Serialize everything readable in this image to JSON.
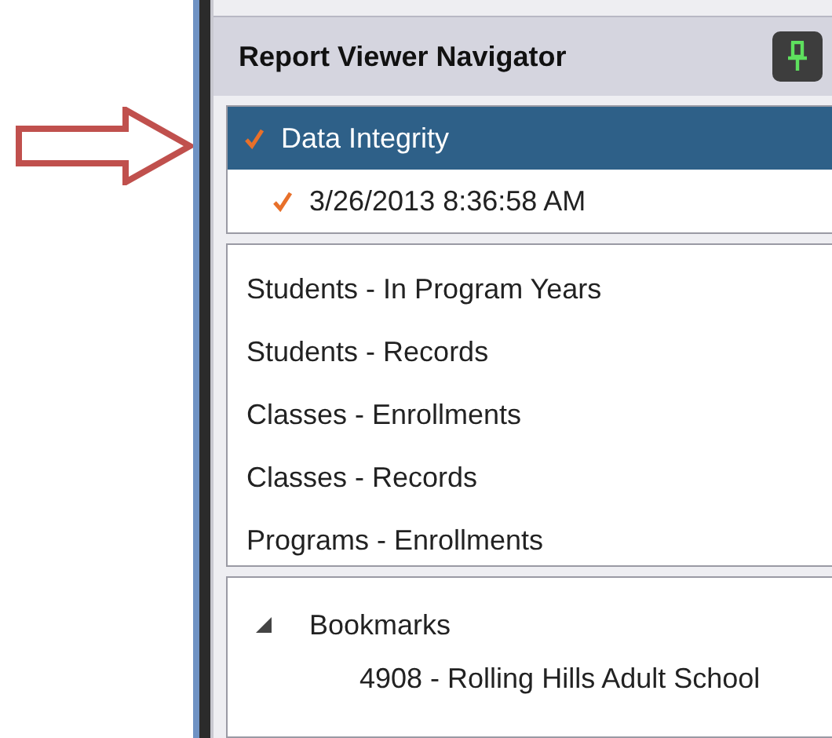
{
  "panel": {
    "title": "Report Viewer Navigator",
    "pin_button": {
      "pinned": true
    }
  },
  "report_tree": [
    {
      "label": "Data Integrity",
      "checked": true,
      "selected": true
    },
    {
      "label": "3/26/2013 8:36:58 AM",
      "checked": true,
      "selected": false
    }
  ],
  "reports": [
    {
      "label": "Students - In Program Years",
      "selected": false
    },
    {
      "label": "Students - Records",
      "selected": false
    },
    {
      "label": "Classes - Enrollments",
      "selected": false
    },
    {
      "label": "Classes - Records",
      "selected": false
    },
    {
      "label": "Programs - Enrollments",
      "selected": false
    }
  ],
  "bookmarks": {
    "label": "Bookmarks",
    "expanded": true,
    "children": [
      {
        "label": "4908 - Rolling Hills Adult School"
      }
    ]
  }
}
